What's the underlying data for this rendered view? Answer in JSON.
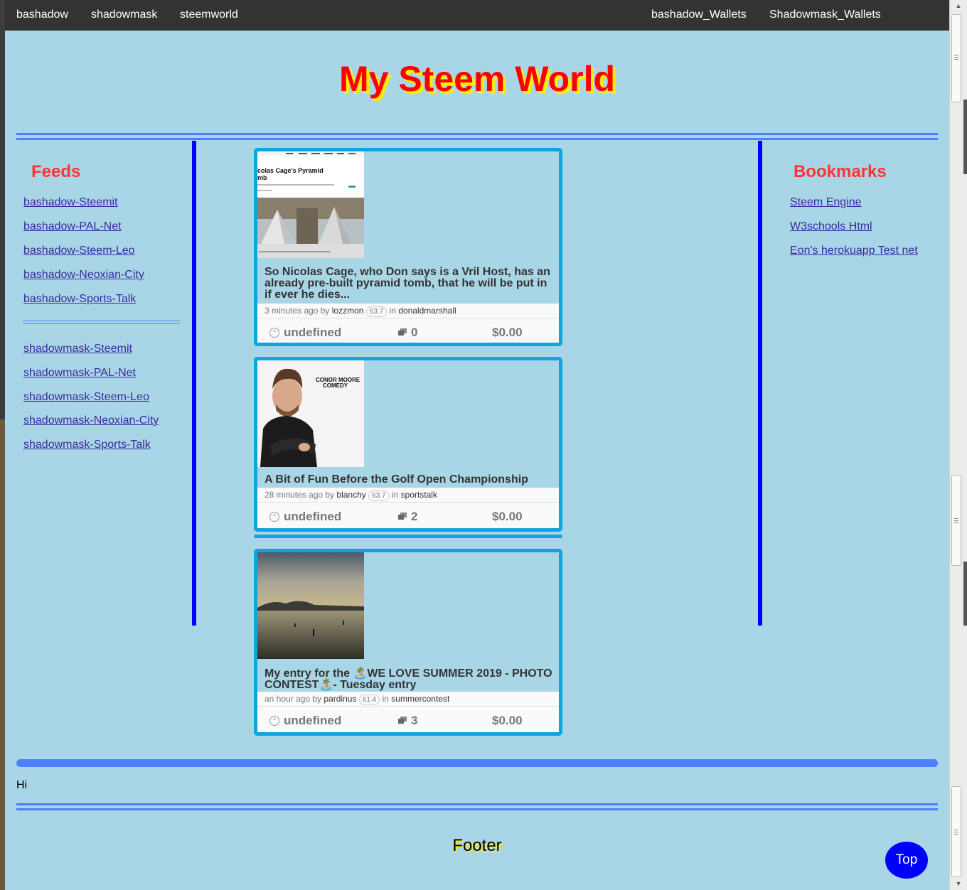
{
  "topnav": {
    "left": [
      "bashadow",
      "shadowmask",
      "steemworld"
    ],
    "right": [
      "bashadow_Wallets",
      "Shadowmask_Wallets"
    ]
  },
  "header": {
    "title": "My Steem World"
  },
  "feeds": {
    "heading": "Feeds",
    "group1": [
      "bashadow-Steemit",
      "bashadow-PAL-Net",
      "bashadow-Steem-Leo",
      "bashadow-Neoxian-City",
      "bashadow-Sports-Talk"
    ],
    "group2": [
      "shadowmask-Steemit",
      "shadowmask-PAL-Net",
      "shadowmask-Steem-Leo",
      "shadowmask-Neoxian-City",
      "shadowmask-Sports-Talk"
    ]
  },
  "bookmarks": {
    "heading": "Bookmarks",
    "links": [
      "Steem Engine",
      "W3schools Html",
      "Eon's herokuapp Test net"
    ]
  },
  "posts": [
    {
      "thumb_text": "colas Cage's Pyramid\nmb",
      "title": "So Nicolas Cage, who Don says is a Vril Host, has an already pre-built pyramid tomb, that he will be put in if ever he dies...",
      "time": "3 minutes ago by",
      "author": "lozzmon",
      "rep": "63.7",
      "in": "in",
      "community": "donaldmarshall",
      "votes": "undefined",
      "comments": "0",
      "payout": "$0.00"
    },
    {
      "thumb_text": "CONOR MOORE\nCOMEDY",
      "title": "A Bit of Fun Before the Golf Open Championship",
      "time": "28 minutes ago by",
      "author": "blanchy",
      "rep": "63.7",
      "in": "in",
      "community": "sportstalk",
      "votes": "undefined",
      "comments": "2",
      "payout": "$0.00"
    },
    {
      "title": "My entry for the 🏝️WE LOVE SUMMER 2019 - PHOTO CONTEST🏝️- Tuesday entry",
      "time": "an hour ago by",
      "author": "pardinus",
      "rep": "61.4",
      "in": "in",
      "community": "summercontest",
      "votes": "undefined",
      "comments": "3",
      "payout": "$0.00"
    }
  ],
  "content": {
    "hi": "Hi"
  },
  "footer": {
    "text": "Footer"
  },
  "top_button": {
    "label": "Top"
  },
  "colors": {
    "background": "#a8d6e6",
    "title_red": "#ff0000",
    "title_shadow": "#ffee00",
    "rule_blue": "#4d7fff",
    "vertical_rule": "#0000ff",
    "card_border": "#0ea5dc",
    "link": "#3b2aa0",
    "top_button": "#0000ff"
  }
}
